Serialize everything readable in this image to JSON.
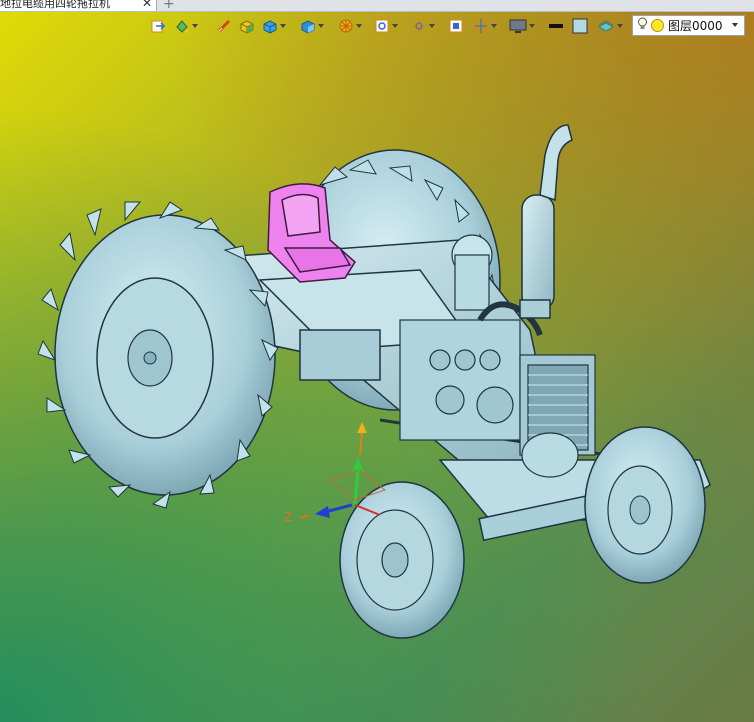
{
  "window": {
    "tab_title": "地拉电缆用四轮拖拉机",
    "close_glyph": "✕",
    "new_tab_glyph": "+"
  },
  "toolbar": {
    "icons": [
      "exit-sketch-icon",
      "paint-bucket-icon",
      "measure-icon",
      "box-solid-icon",
      "view-cube-icon",
      "display-mode-icon",
      "render-style-icon",
      "zoom-fit-icon",
      "pan-icon",
      "frame-icon",
      "section-icon",
      "monitor-icon",
      "line-color-icon",
      "fill-color-icon",
      "layer-icon"
    ],
    "layer": {
      "name": "图层0000",
      "light_color": "#ffe42a"
    }
  },
  "viewport": {
    "triad": {
      "z_label": "Z"
    },
    "colors": {
      "part": "#b5d9e3",
      "seat": "#ee82ee",
      "edge": "#1f3540"
    }
  }
}
